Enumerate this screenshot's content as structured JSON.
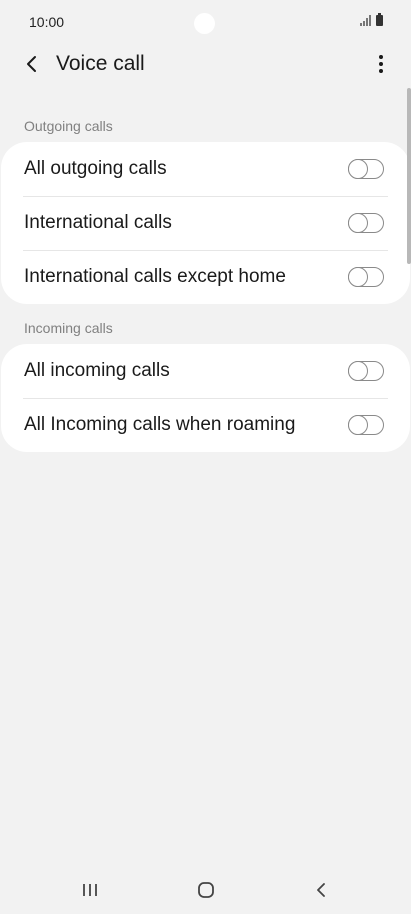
{
  "status_bar": {
    "time": "10:00",
    "icons": [
      "signal-icon",
      "battery-icon"
    ]
  },
  "app_bar": {
    "title": "Voice call",
    "back_icon": "chevron-left-icon",
    "more_icon": "more-vertical-icon"
  },
  "sections": [
    {
      "header": "Outgoing calls",
      "items": [
        {
          "label": "All outgoing calls",
          "enabled": false
        },
        {
          "label": "International calls",
          "enabled": false
        },
        {
          "label": "International calls except home",
          "enabled": false
        }
      ]
    },
    {
      "header": "Incoming calls",
      "items": [
        {
          "label": "All incoming calls",
          "enabled": false
        },
        {
          "label": "All Incoming calls when roaming",
          "enabled": false
        }
      ]
    }
  ],
  "nav_bar": {
    "icons": [
      "recent-apps-icon",
      "home-icon",
      "back-icon"
    ]
  }
}
